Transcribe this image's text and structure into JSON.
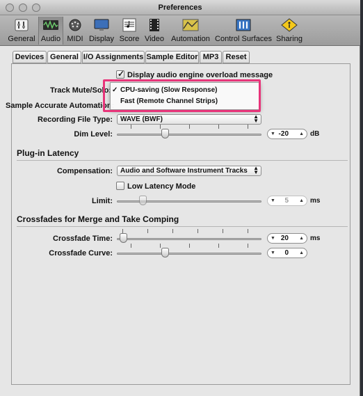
{
  "window": {
    "title": "Preferences"
  },
  "toolbar": {
    "items": [
      {
        "label": "General",
        "icon": "general-icon",
        "selected": false
      },
      {
        "label": "Audio",
        "icon": "audio-icon",
        "selected": true
      },
      {
        "label": "MIDI",
        "icon": "midi-icon",
        "selected": false
      },
      {
        "label": "Display",
        "icon": "display-icon",
        "selected": false
      },
      {
        "label": "Score",
        "icon": "score-icon",
        "selected": false
      },
      {
        "label": "Video",
        "icon": "video-icon",
        "selected": false
      },
      {
        "label": "Automation",
        "icon": "automation-icon",
        "selected": false
      },
      {
        "label": "Control Surfaces",
        "icon": "control-surfaces-icon",
        "selected": false
      },
      {
        "label": "Sharing",
        "icon": "sharing-icon",
        "selected": false
      }
    ]
  },
  "tabs": [
    {
      "label": "Devices",
      "active": false
    },
    {
      "label": "General",
      "active": true
    },
    {
      "label": "I/O Assignments",
      "active": false
    },
    {
      "label": "Sample Editor",
      "active": false
    },
    {
      "label": "MP3",
      "active": false
    },
    {
      "label": "Reset",
      "active": false
    }
  ],
  "general": {
    "overload_checkbox": {
      "label": "Display audio engine overload message",
      "checked": true
    },
    "track_mute_label": "Track Mute/Solo:",
    "sample_accurate_label": "Sample Accurate Automation:",
    "recording_file_type": {
      "label": "Recording File Type:",
      "value": "WAVE (BWF)"
    },
    "dim_level": {
      "label": "Dim Level:",
      "value": "-20",
      "unit": "dB"
    }
  },
  "plugin_latency": {
    "title": "Plug-in Latency",
    "compensation": {
      "label": "Compensation:",
      "value": "Audio and Software Instrument Tracks"
    },
    "low_latency": {
      "label": "Low Latency Mode",
      "checked": false
    },
    "limit": {
      "label": "Limit:",
      "value": "5",
      "unit": "ms"
    }
  },
  "crossfades": {
    "title": "Crossfades for Merge and Take Comping",
    "time": {
      "label": "Crossfade Time:",
      "value": "20",
      "unit": "ms"
    },
    "curve": {
      "label": "Crossfade Curve:",
      "value": "0"
    }
  },
  "dropdown_menu": {
    "items": [
      {
        "label": "CPU-saving (Slow Response)",
        "checked": true
      },
      {
        "label": "Fast (Remote Channel Strips)",
        "checked": false
      }
    ],
    "highlight_color": "#e8357a"
  }
}
